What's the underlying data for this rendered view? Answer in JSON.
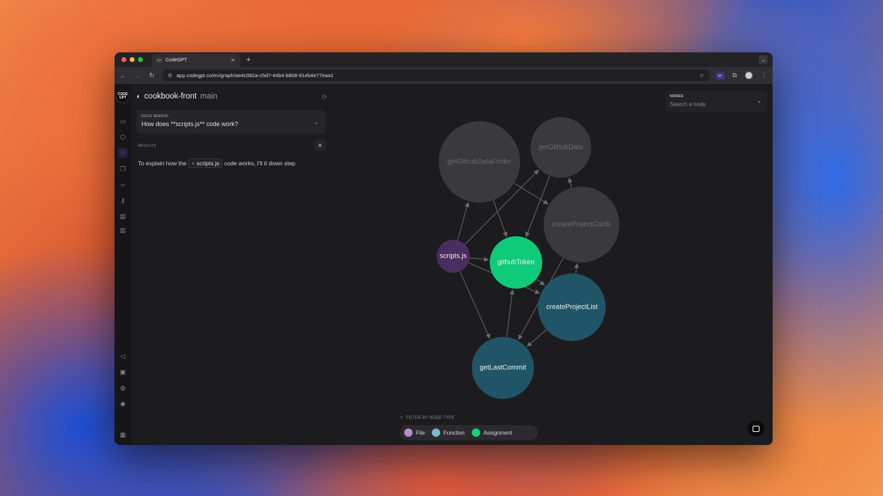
{
  "browser": {
    "tab_title": "CodeGPT",
    "tab_favicon": "GPT",
    "url": "app.codegpt.co/en/graph/ae4c082a-c5d7-44b4-b808-91eb4e77eaa1",
    "ext_badge": "AP"
  },
  "app": {
    "logo": "CODE GPT",
    "repo_name": "cookbook-front",
    "branch": "main",
    "docs_search": {
      "title": "DOCS SEARCH",
      "query": "How does **scripts.js** code work?"
    },
    "results": {
      "label": "RESULTS",
      "text_before": "To explain how the",
      "code_chip": "scripts.js",
      "text_after": "code works, I'll it down step"
    },
    "nodes_panel": {
      "title": "NODES",
      "placeholder": "Search a node"
    },
    "filter": {
      "label": "FILTER BY NODE TYPE",
      "types": [
        {
          "label": "File",
          "color": "#b48fc9"
        },
        {
          "label": "Function",
          "color": "#7fb6cf"
        },
        {
          "label": "Assignment",
          "color": "#10d47a"
        }
      ]
    }
  },
  "graph": {
    "colors": {
      "file": "#4a2d60",
      "assignment": "#0ecb7a",
      "function_active": "#1f5566",
      "inactive": "#3a3a3c",
      "edge": "#5e5e62"
    },
    "nodes": [
      {
        "id": "getGithubDataFolder",
        "label": "getGithubDataFolder",
        "type": "function",
        "active": false
      },
      {
        "id": "getGithubData",
        "label": "getGithubData",
        "type": "function",
        "active": false
      },
      {
        "id": "createProjectCards",
        "label": "createProjectCards",
        "type": "function",
        "active": false
      },
      {
        "id": "scripts",
        "label": "scripts.js",
        "type": "file",
        "active": true
      },
      {
        "id": "githubToken",
        "label": "githubToken",
        "type": "assignment",
        "active": true
      },
      {
        "id": "createProjectList",
        "label": "createProjectList",
        "type": "function",
        "active": true
      },
      {
        "id": "getLastCommit",
        "label": "getLastCommit",
        "type": "function",
        "active": true
      }
    ],
    "edges": [
      [
        "scripts",
        "getGithubDataFolder"
      ],
      [
        "scripts",
        "githubToken"
      ],
      [
        "scripts",
        "createProjectList"
      ],
      [
        "scripts",
        "getLastCommit"
      ],
      [
        "scripts",
        "getGithubData"
      ],
      [
        "getGithubDataFolder",
        "githubToken"
      ],
      [
        "getGithubDataFolder",
        "createProjectCards"
      ],
      [
        "getGithubData",
        "githubToken"
      ],
      [
        "createProjectCards",
        "getGithubData"
      ],
      [
        "createProjectList",
        "createProjectCards"
      ],
      [
        "createProjectList",
        "getLastCommit"
      ],
      [
        "getLastCommit",
        "githubToken"
      ],
      [
        "githubToken",
        "createProjectList"
      ],
      [
        "createProjectCards",
        "getLastCommit"
      ]
    ]
  }
}
